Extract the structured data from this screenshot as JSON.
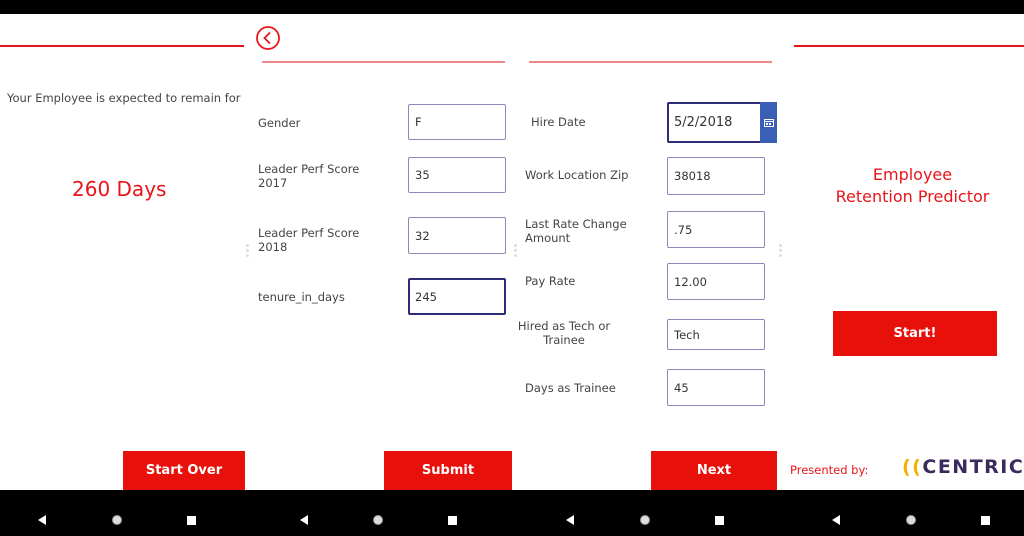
{
  "result_panel": {
    "intro": "Your Employee is expected to remain for",
    "result": "260 Days",
    "start_over_label": "Start Over"
  },
  "form_panel_1": {
    "back_icon": "chevron-left-circle-icon",
    "fields": [
      {
        "label": "Gender",
        "value": "F"
      },
      {
        "label": "Leader Perf Score 2017",
        "value": "35"
      },
      {
        "label": "Leader Perf Score 2018",
        "value": "32"
      },
      {
        "label": "tenure_in_days",
        "value": "245"
      }
    ],
    "submit_label": "Submit"
  },
  "form_panel_2": {
    "fields": [
      {
        "label": "Hire Date",
        "value": "5/2/2018",
        "icon": "calendar-icon"
      },
      {
        "label": "Work Location Zip",
        "value": "38018"
      },
      {
        "label": "Last Rate Change Amount",
        "value": ".75"
      },
      {
        "label": "Pay Rate",
        "value": "12.00"
      },
      {
        "label": "Hired as Tech or Trainee",
        "value": "Tech"
      },
      {
        "label": "Days as Trainee",
        "value": "45"
      }
    ],
    "next_label": "Next"
  },
  "start_panel": {
    "title_line1": "Employee",
    "title_line2": "Retention Predictor",
    "start_label": "Start!",
    "presented_by": "Presented by:",
    "logo_brackets": "((",
    "logo_text": "CENTRIC",
    "logo_close": ")"
  },
  "colors": {
    "accent_red": "#e8141a",
    "button_red": "#e8100b",
    "input_border": "#8a8ab8",
    "focus_border": "#2b2b7a",
    "calendar_blue": "#3a5fb5",
    "logo_purple": "#3b2a5e",
    "logo_orange": "#f2b100"
  },
  "android_nav": {
    "back_icon": "back-triangle-icon",
    "home_icon": "home-circle-icon",
    "recents_icon": "recents-square-icon"
  }
}
